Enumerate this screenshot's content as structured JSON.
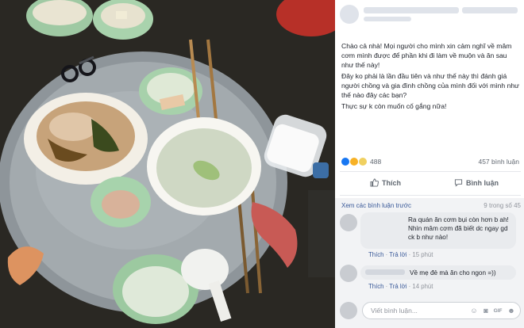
{
  "post": {
    "author_name_blurred": "",
    "text_lines": [
      "Chào cả nhà! Mọi người cho mình xin cảm nghĩ về mâm cơm mình được để phần khi đi làm về muộn và ăn sau như thế này!",
      "Đây ko phải là lần đầu tiên và như thế này thì đánh giá người chồng và gia đình chồng của mình đối với mình như thế nào đây các bạn?",
      "Thực sự k còn muốn cố gắng nữa!"
    ],
    "reaction_count": "488",
    "comment_count": "457 bình luận"
  },
  "actions": {
    "like_label": "Thích",
    "comment_label": "Bình luận"
  },
  "comments": {
    "view_previous": "Xem các bình luận trước",
    "of_count": "9 trong số 45",
    "items": [
      {
        "text": "Ra quán ăn cơm bụi còn hơn b ah! Nhìn mâm cơm đã biết dc ngay gd ck b như nào!",
        "like": "Thích",
        "reply": "Trả lời",
        "time": "15 phút"
      },
      {
        "text": "Về mẹ đẻ mà ăn cho ngon =))",
        "like": "Thích",
        "reply": "Trả lời",
        "time": "14 phút"
      }
    ],
    "input_placeholder": "Viết bình luận..."
  },
  "colors": {
    "link": "#385898",
    "like_blue": "#1877f2",
    "muted": "#90949c",
    "bubble": "#e9ebee"
  },
  "icons": {
    "like": "thumbs-up-icon",
    "comment": "speech-bubble-icon",
    "emoji": "smiley-icon",
    "camera": "camera-icon",
    "gif": "gif-icon",
    "sticker": "sticker-icon"
  }
}
